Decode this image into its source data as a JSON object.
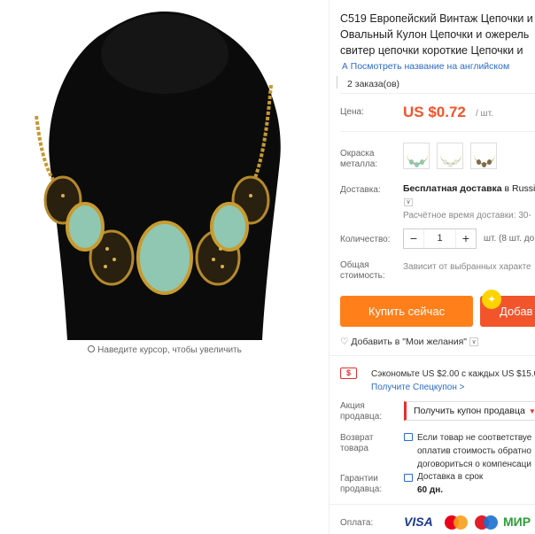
{
  "product": {
    "title_lines": [
      "C519 Европейский Винтаж Цепочки и",
      "Овальный Кулон Цепочки и ожерель",
      "свитер цепочки короткие Цепочки и"
    ],
    "translate_link": "Посмотреть название на английском",
    "orders": "2 заказа(ов)",
    "zoom_hint": "Наведите курсор, чтобы увеличить"
  },
  "price": {
    "label": "Цена:",
    "value": "US $0.72",
    "unit": "/ шт."
  },
  "color": {
    "label_line1": "Окраска",
    "label_line2": "металла:",
    "swatches": [
      {
        "name": "swatch-green",
        "gem": "#8fc7b3"
      },
      {
        "name": "swatch-white",
        "gem": "#e9efe9"
      },
      {
        "name": "swatch-bronze",
        "gem": "#7b6a52"
      }
    ]
  },
  "delivery": {
    "label": "Доставка:",
    "value_bold": "Бесплатная доставка",
    "value_rest": " в Russia",
    "estimate": "Расчётное время доставки: 30-"
  },
  "quantity": {
    "label": "Количество:",
    "minus": "−",
    "value": "1",
    "plus": "+",
    "suffix": "шт. (8 шт. до"
  },
  "total": {
    "label_line1": "Общая",
    "label_line2": "стоимость:",
    "value": "Зависит от выбранных характе"
  },
  "actions": {
    "buy_now": "Купить сейчас",
    "add_to_cart": "Добав",
    "wishlist": "Добавить в \"Мои желания\""
  },
  "promo": {
    "text": "Сэкономьте US $2.00 с каждых US $15.0",
    "link": "Получите Спецкупон >"
  },
  "seller_promo": {
    "label_line1": "Акция",
    "label_line2": "продавца:",
    "select_value": "Получить купон продавца"
  },
  "returns": {
    "label_line1": "Возврат",
    "label_line2": "товара",
    "lines": [
      "Если товар не соответствуе",
      "оплатив стоимость обратно",
      "договориться о компенсаци"
    ]
  },
  "guarantee": {
    "label_line1": "Гарантии",
    "label_line2": "продавца:",
    "text": "Доставка в срок",
    "days": "60 дн."
  },
  "payment": {
    "label": "Оплата:",
    "visa": "VISA",
    "mir": "МИР"
  },
  "colors": {
    "accent_orange": "#ff7f1b",
    "price_red": "#f2532b",
    "link_blue": "#2a6bcc",
    "cart_red": "#f2542c"
  }
}
